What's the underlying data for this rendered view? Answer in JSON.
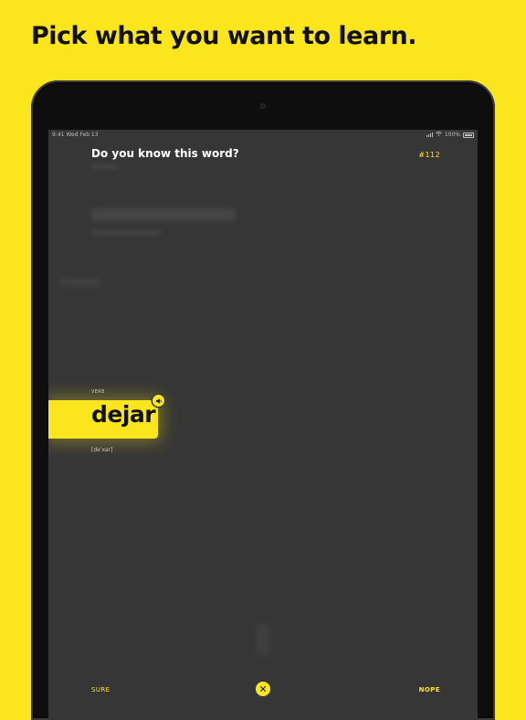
{
  "headline": "Pick what you want to learn.",
  "status_bar": {
    "time": "9:41",
    "date": "Wed Feb 13",
    "battery": "100%"
  },
  "screen": {
    "question": "Do you know this word?",
    "word_number": "#112",
    "part_of_speech": "VERB",
    "word": "dejar",
    "pronunciation": "[deˈxar]",
    "sure_label": "SURE",
    "nope_label": "NOPE"
  },
  "colors": {
    "accent": "#FBE51D",
    "screen_bg": "#363636",
    "device_frame": "#0e0e0e"
  },
  "icons": [
    "speaker-icon",
    "close-icon",
    "wifi-icon",
    "signal-icon",
    "battery-icon"
  ]
}
